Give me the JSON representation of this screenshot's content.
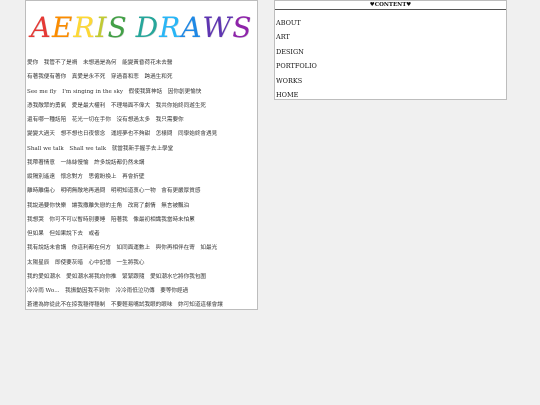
{
  "logo": {
    "letters": [
      {
        "ch": "A",
        "color": "#e53935"
      },
      {
        "ch": "E",
        "color": "#fb8c00"
      },
      {
        "ch": "R",
        "color": "#fdd835"
      },
      {
        "ch": "I",
        "color": "#c0ca33"
      },
      {
        "ch": "S",
        "color": "#43a047"
      },
      {
        "ch": " ",
        "color": "#000000"
      },
      {
        "ch": "D",
        "color": "#26a69a"
      },
      {
        "ch": "R",
        "color": "#29b6f6"
      },
      {
        "ch": "A",
        "color": "#1e88e5"
      },
      {
        "ch": "W",
        "color": "#5e35b1"
      },
      {
        "ch": "S",
        "color": "#8e24aa"
      }
    ]
  },
  "lyrics": [
    "愛你　我管不了是禍　未想過是為何　能變黃昏荷花未去醫",
    "有著我便有著你　真愛是永不死　穿過喜和悲　跨過生和死",
    "See me fly　I'm singing in the sky　假使我算神話　因你創更愉快",
    "憑我敵眾的勇氣　愛是最大權利　不理場面不偉大　我共你始終同遊生死",
    "還有哪一種話陪　花光一切在手你　沒有想過太多　我只需要你",
    "變變大過天　想不想也日夜懷念　運經夢也不夠甜　怎樣問　同學始終會遇見",
    "Shall we talk　Shall we talk　就當我新手握手去上學堂",
    "我帶著情意　一絲絲慢愉　許多說話都仍然未講",
    "縱隔別遙遠　懷念對方　思僱盼換上　再會折壁",
    "離時離傷心　明明無敵地再過問　明明知道衷心一物　會有更嚴厚質感",
    "我說過要你快樂　讓我撒離失戀的主角　改寫了劇情　無言被飄泊",
    "我想哭　你可不可以暫時別要睡　陪著我　像最初相識我當時未怕累",
    "但如果　但如果說下去　或者",
    "我有說話未會講　你這利都在何方　如同面運數上　與你再相伴在寄　如最光",
    "太陽星辰　即使要灰暗　心中記憶　一生將我心",
    "我的愛如潮水　愛如潮水將我向你推　緊緊跟隨　愛如潮水它將你我包圍",
    "冷冷雨 Wo...　我振動因我不到你　冷冷雨低泣功傳　要等你經過",
    "蒼遷為妳從此不在掠我穩得穩制　不要輕易嘴試我眼的眼味　妳可知道這樣會讓"
  ],
  "sidebar": {
    "header": "♥CONTENT♥",
    "nav": [
      "ABOUT",
      "ART",
      "DESIGN",
      "PORTFOLIO",
      "WORKS",
      "HOME"
    ]
  }
}
